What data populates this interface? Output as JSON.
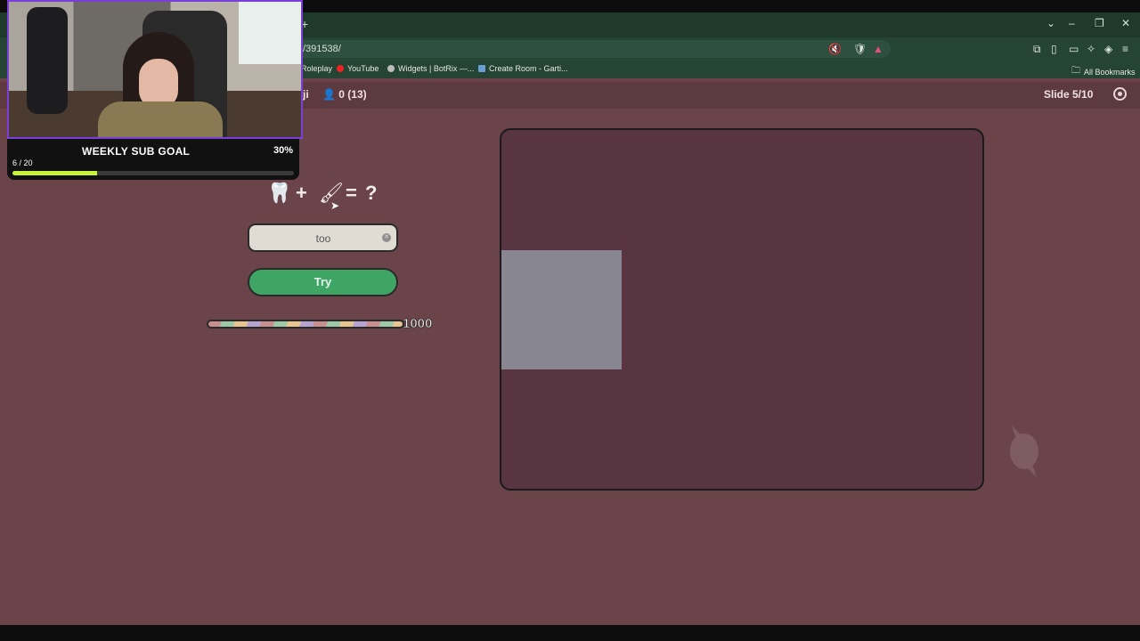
{
  "browser": {
    "url": "/391538/",
    "bookmarks": [
      "Roleplay",
      "YouTube",
      "Widgets | BotRix —...",
      "Create Room - Garti..."
    ],
    "all_bookmarks": "All Bookmarks",
    "new_tab": "+"
  },
  "game": {
    "topbar_fragment": "ji",
    "players": "0 (13)",
    "slide": "Slide 5/10",
    "equation": {
      "plus": "+",
      "equals": "=",
      "question": "?"
    },
    "answer_value": "too",
    "try_label": "Try",
    "score": "1000"
  },
  "stream": {
    "goal_title": "WEEKLY SUB GOAL",
    "goal_percent": "30%",
    "goal_count": "6 / 20",
    "goal_fraction": 0.3
  },
  "colors": {
    "page_bg": "#6a4449",
    "canvas_bg": "#583540",
    "try_green": "#3fa565",
    "goal_fill": "#c6f43a"
  }
}
